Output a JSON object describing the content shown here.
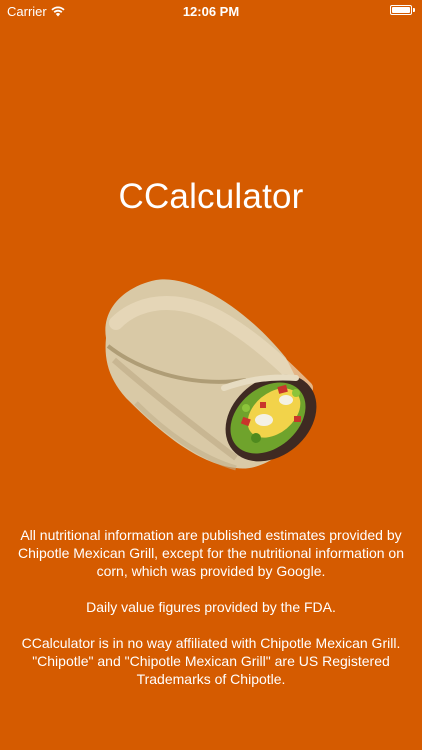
{
  "status_bar": {
    "carrier": "Carrier",
    "time": "12:06 PM"
  },
  "app": {
    "title": "CCalculator"
  },
  "info": {
    "paragraph1": "All nutritional information are published estimates provided by Chipotle Mexican Grill, except for the nutritional information on corn, which was provided by Google.",
    "paragraph2": "Daily value figures provided by the FDA.",
    "paragraph3": "CCalculator is in no way affiliated with Chipotle Mexican Grill. \"Chipotle\" and \"Chipotle Mexican Grill\" are US Registered Trademarks of Chipotle."
  },
  "colors": {
    "background": "#d55b00",
    "text": "#ffffff"
  },
  "icons": {
    "wifi": "wifi-icon",
    "battery": "battery-icon",
    "hero": "burrito-illustration"
  }
}
